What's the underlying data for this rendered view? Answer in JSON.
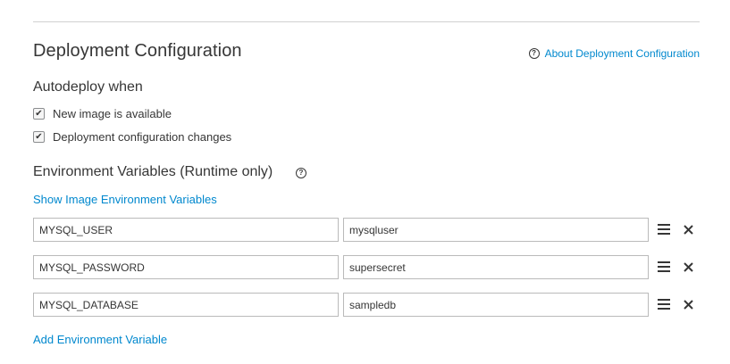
{
  "deployment": {
    "title": "Deployment Configuration",
    "help_link": "About Deployment Configuration"
  },
  "autodeploy": {
    "title": "Autodeploy when",
    "options": [
      {
        "label": "New image is available",
        "checked": true
      },
      {
        "label": "Deployment configuration changes",
        "checked": true
      }
    ]
  },
  "env": {
    "title": "Environment Variables (Runtime only)",
    "show_image_link": "Show Image Environment Variables",
    "rows": [
      {
        "name": "MYSQL_USER",
        "value": "mysqluser"
      },
      {
        "name": "MYSQL_PASSWORD",
        "value": "supersecret"
      },
      {
        "name": "MYSQL_DATABASE",
        "value": "sampledb"
      }
    ],
    "add_link": "Add Environment Variable"
  },
  "icons": {
    "help": "question-circle-icon",
    "drag": "drag-handle-icon",
    "remove": "close-icon"
  },
  "colors": {
    "link": "#0088ce",
    "text": "#363636",
    "border": "#bababa"
  }
}
